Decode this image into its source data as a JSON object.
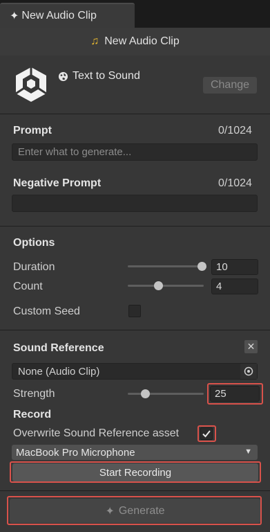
{
  "tab": {
    "icon": "sparkle-icon",
    "label": "New Audio Clip"
  },
  "header": {
    "icon": "music-note-icon",
    "title": "New Audio Clip"
  },
  "model": {
    "icon": "globe-icon",
    "name": "Text to Sound",
    "change_label": "Change",
    "logo": "unity-logo"
  },
  "prompt": {
    "label": "Prompt",
    "counter": "0/1024",
    "placeholder": "Enter what to generate...",
    "value": ""
  },
  "negative_prompt": {
    "label": "Negative Prompt",
    "counter": "0/1024",
    "value": ""
  },
  "options": {
    "title": "Options",
    "duration": {
      "label": "Duration",
      "value": "10",
      "slider_fraction": 1.0
    },
    "count": {
      "label": "Count",
      "value": "4",
      "slider_fraction": 0.4
    },
    "custom_seed": {
      "label": "Custom Seed",
      "checked": false
    }
  },
  "sound_reference": {
    "title": "Sound Reference",
    "asset": "None (Audio Clip)",
    "strength": {
      "label": "Strength",
      "value": "25",
      "slider_fraction": 0.25
    }
  },
  "record": {
    "title": "Record",
    "overwrite_label": "Overwrite Sound Reference asset",
    "overwrite_checked": true,
    "microphone": "MacBook Pro Microphone",
    "start_label": "Start Recording"
  },
  "generate": {
    "label": "Generate",
    "enabled": false
  },
  "colors": {
    "highlight": "#d9524b",
    "note": "#e8b931"
  }
}
